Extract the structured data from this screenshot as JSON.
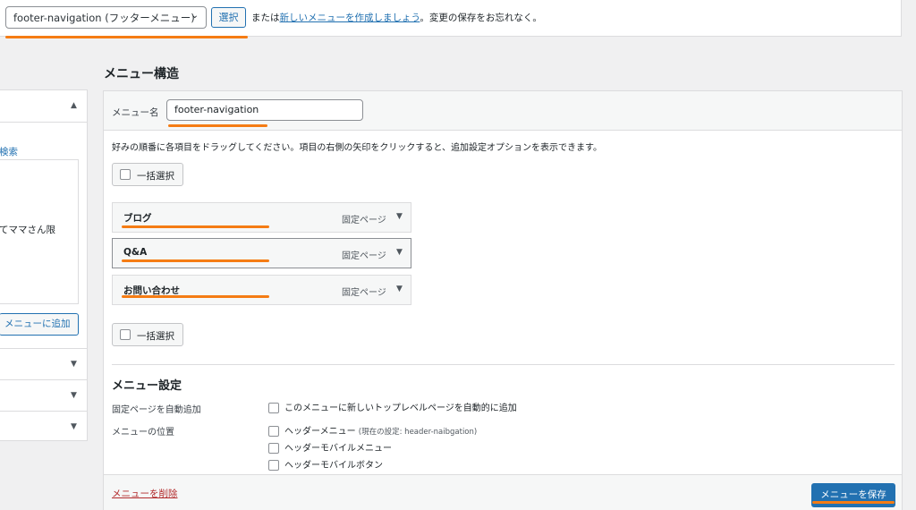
{
  "top": {
    "menu_select_value": "footer-navigation (フッターメニュー)",
    "select_button": "選択",
    "note_pre": "または",
    "note_link": "新しいメニューを作成しましょう",
    "note_post": "。変更の保存をお忘れなく。"
  },
  "left_panel": {
    "search_link": "検索",
    "partial_item": "てママさん限",
    "add_button": "メニューに追加"
  },
  "structure": {
    "heading": "メニュー構造",
    "name_label": "メニュー名",
    "name_value": "footer-navigation",
    "instructions": "好みの順番に各項目をドラッグしてください。項目の右側の矢印をクリックすると、追加設定オプションを表示できます。",
    "bulk_select": "一括選択",
    "items": [
      {
        "title": "ブログ",
        "type": "固定ページ"
      },
      {
        "title": "Q&A",
        "type": "固定ページ"
      },
      {
        "title": "お問い合わせ",
        "type": "固定ページ"
      }
    ]
  },
  "settings": {
    "heading": "メニュー設定",
    "auto_add_label": "固定ページを自動追加",
    "auto_add_option": "このメニューに新しいトップレベルページを自動的に追加",
    "location_label": "メニューの位置",
    "locations": [
      {
        "label": "ヘッダーメニュー",
        "note": "(現在の設定: header-naibgation)"
      },
      {
        "label": "ヘッダーモバイルメニュー",
        "note": ""
      },
      {
        "label": "ヘッダーモバイルボタン",
        "note": ""
      }
    ]
  },
  "footer": {
    "delete_link": "メニューを削除",
    "save_button": "メニューを保存"
  },
  "colors": {
    "accent": "#2271b1",
    "highlight_underline": "#f57c14",
    "delete": "#b32d2e"
  }
}
